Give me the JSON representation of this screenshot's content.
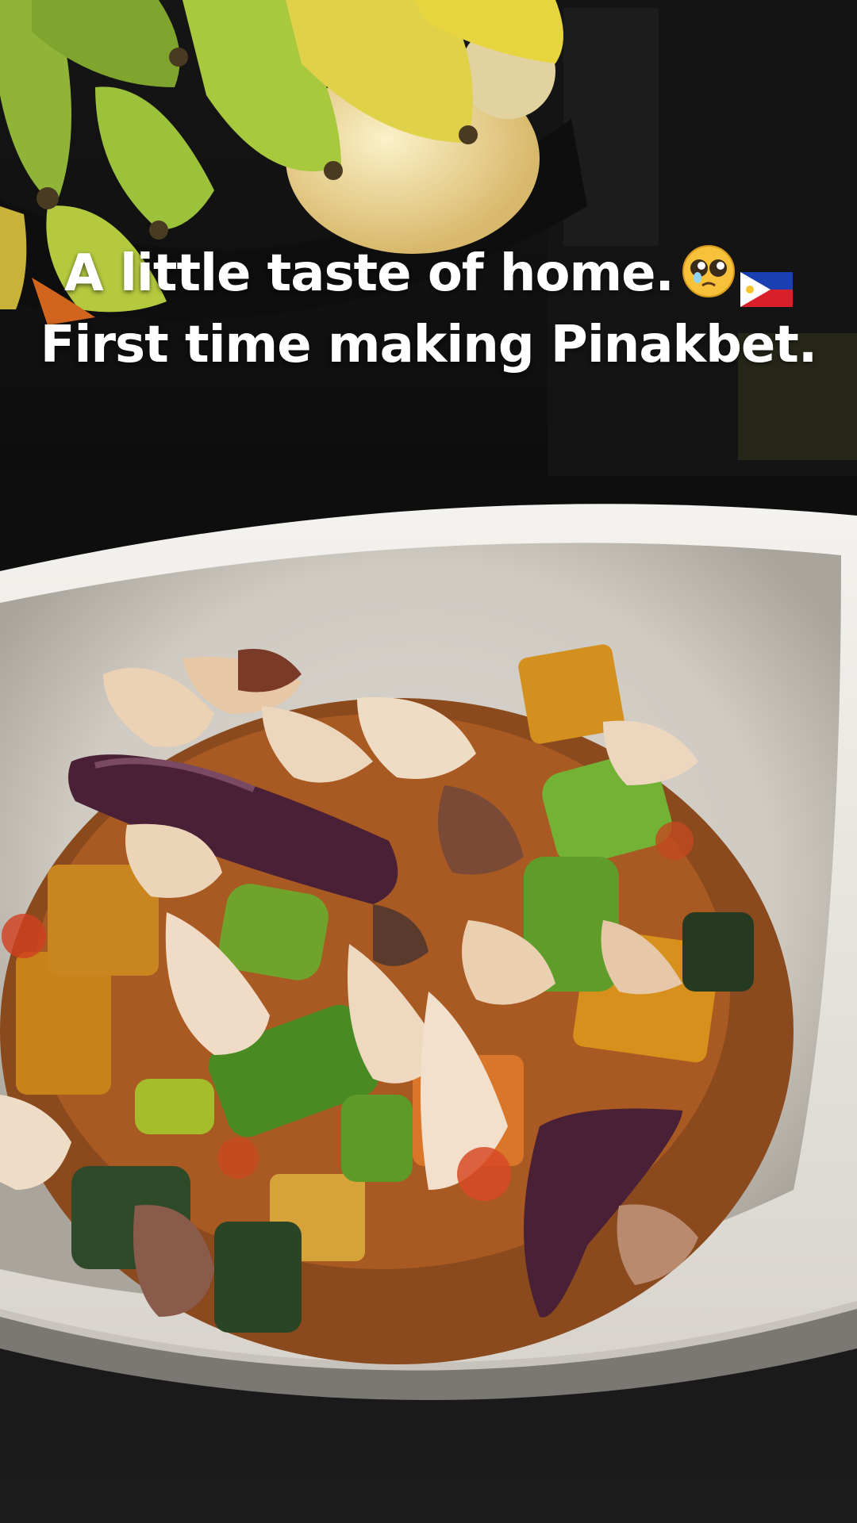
{
  "caption": {
    "line1": "A little taste of home.",
    "line2": "First time making Pinakbet.",
    "emoji": "pleading-face-icon",
    "flag": "philippines-flag-icon"
  },
  "colors": {
    "caption_text": "#ffffff",
    "bowl": "#e8e6e2",
    "banana_green": "#9bbf3a",
    "banana_yellow": "#e6cc3a",
    "counter": "#141414"
  }
}
